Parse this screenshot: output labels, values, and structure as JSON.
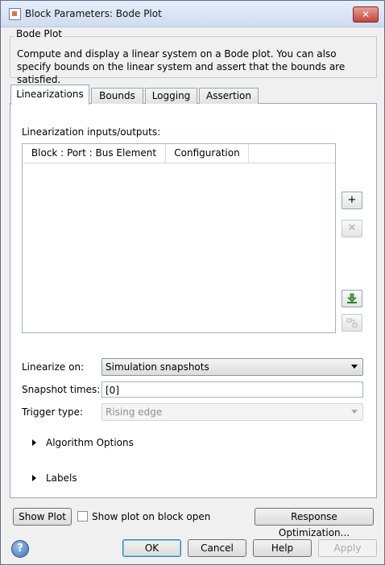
{
  "window": {
    "title": "Block Parameters: Bode Plot",
    "close_glyph": "✕"
  },
  "block": {
    "name": "Bode Plot",
    "description": "Compute and display a linear system on a Bode plot. You can also specify bounds on the linear system and assert that the bounds are satisfied."
  },
  "tabs": [
    {
      "label": "Linearizations",
      "active": true
    },
    {
      "label": "Bounds",
      "active": false
    },
    {
      "label": "Logging",
      "active": false
    },
    {
      "label": "Assertion",
      "active": false
    }
  ],
  "linearizations": {
    "io_label": "Linearization inputs/outputs:",
    "columns": [
      "Block : Port : Bus Element",
      "Configuration"
    ],
    "rows": [],
    "side_buttons": {
      "add": {
        "icon": "plus-icon",
        "glyph": "+",
        "enabled": true
      },
      "remove": {
        "icon": "close-icon",
        "glyph": "✕",
        "enabled": false
      },
      "import": {
        "icon": "download-icon",
        "enabled": true
      },
      "highlight": {
        "icon": "highlight-model-icon",
        "enabled": false
      }
    },
    "linearize_on": {
      "label": "Linearize on:",
      "value": "Simulation snapshots"
    },
    "snapshot_times": {
      "label": "Snapshot times:",
      "value": "[0]"
    },
    "trigger_type": {
      "label": "Trigger type:",
      "value": "Rising edge",
      "enabled": false
    },
    "algorithm_options": "Algorithm Options",
    "labels": "Labels"
  },
  "bottom": {
    "show_plot": "Show Plot",
    "show_plot_on_open": {
      "label": "Show plot on block open",
      "checked": false
    },
    "response_optimization": "Response Optimization..."
  },
  "dialog_buttons": {
    "help_icon_glyph": "?",
    "ok": "OK",
    "cancel": "Cancel",
    "help": "Help",
    "apply": "Apply"
  },
  "colors": {
    "accent": "#3c7fb1",
    "close": "#c7443a",
    "tab_border": "#9aa6b5"
  }
}
